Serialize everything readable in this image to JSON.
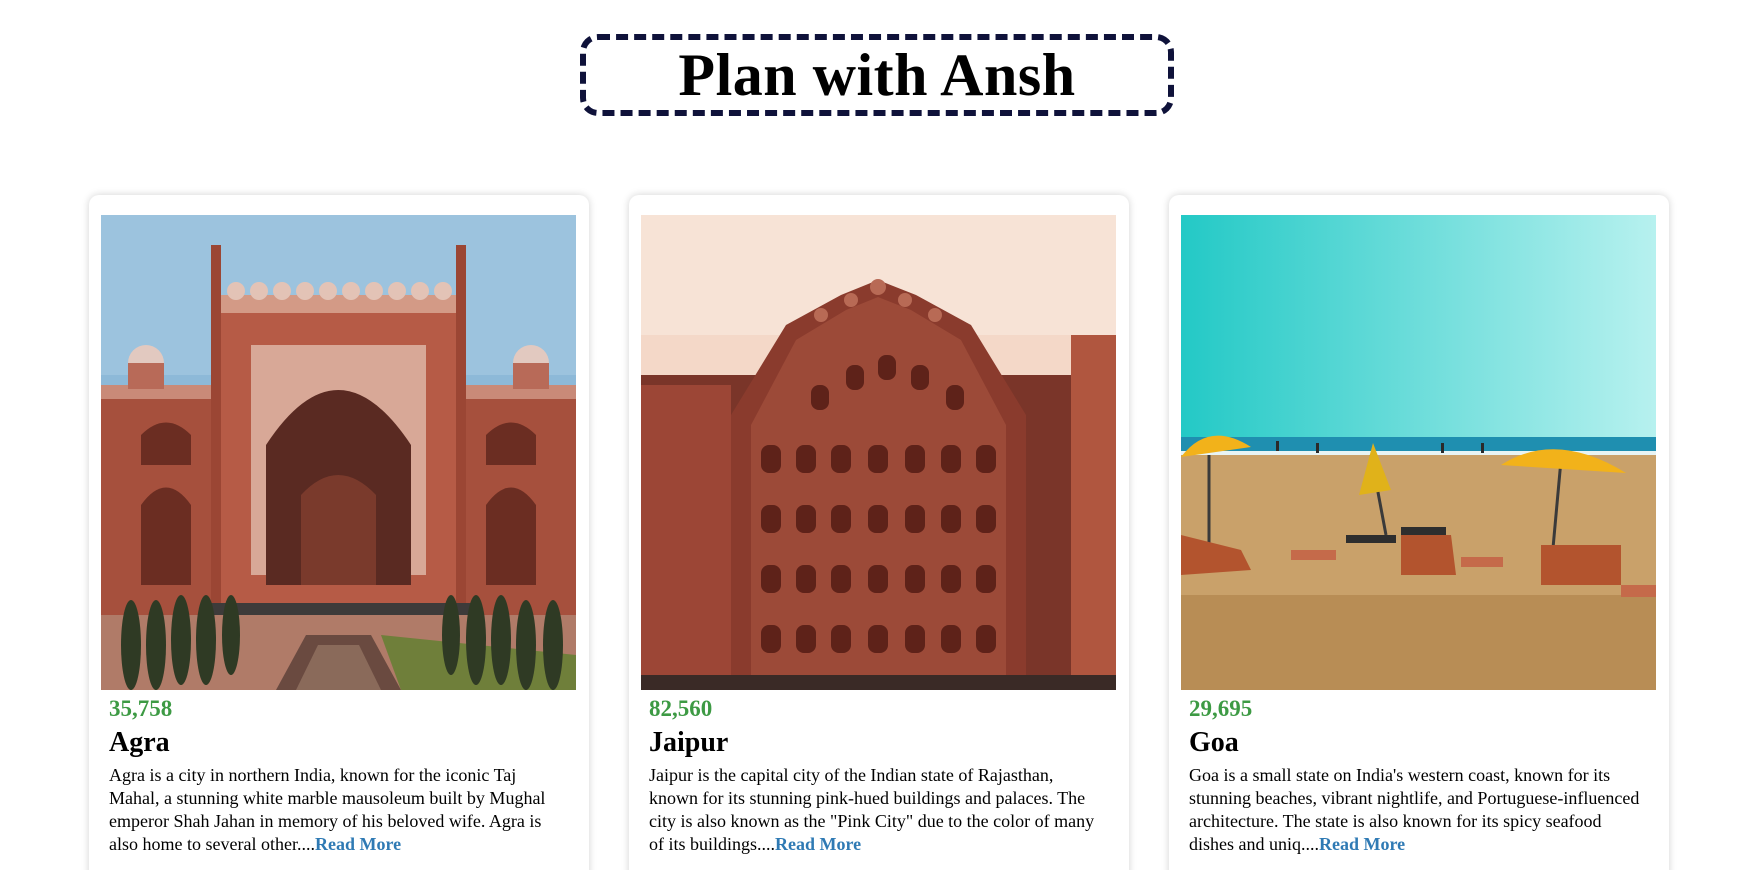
{
  "header": {
    "title": "Plan with Ansh"
  },
  "cards": [
    {
      "count": "35,758",
      "city": "Agra",
      "description": "Agra is a city in northern India, known for the iconic Taj Mahal, a stunning white marble mausoleum built by Mughal emperor Shah Jahan in memory of his beloved wife. Agra is also home to several other....",
      "read_more": "Read More",
      "image_subject": "red sandstone gateway of the Taj Mahal complex"
    },
    {
      "count": "82,560",
      "city": "Jaipur",
      "description": "Jaipur is the capital city of the Indian state of Rajasthan, known for its stunning pink-hued buildings and palaces. The city is also known as the \"Pink City\" due to the color of many of its buildings....",
      "read_more": "Read More",
      "image_subject": "Hawa Mahal pink palace facade"
    },
    {
      "count": "29,695",
      "city": "Goa",
      "description": "Goa is a small state on India's western coast, known for its stunning beaches, vibrant nightlife, and Portuguese-influenced architecture. The state is also known for its spicy seafood dishes and uniq....",
      "read_more": "Read More",
      "image_subject": "beach with yellow umbrellas and sun loungers"
    }
  ],
  "colors": {
    "count_green": "#3d9a44",
    "link_blue": "#2f7ab4",
    "header_border": "#0f123a"
  }
}
